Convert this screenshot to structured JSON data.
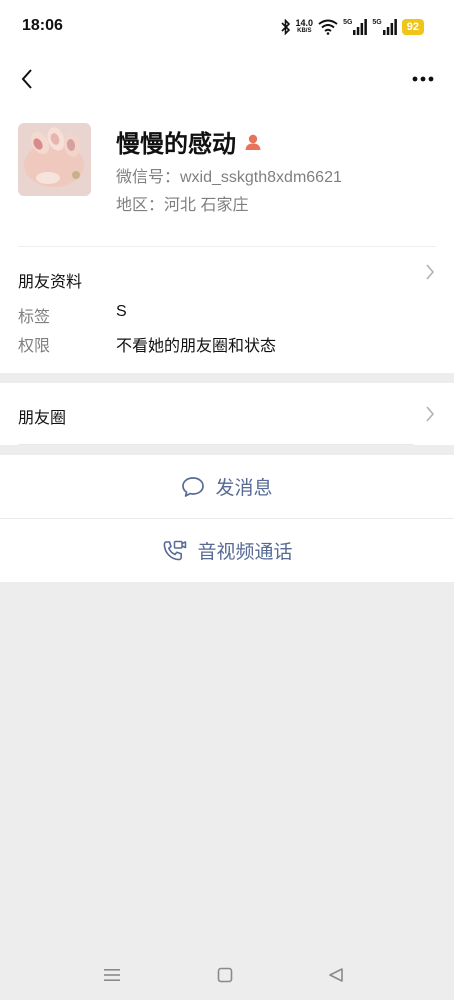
{
  "status_bar": {
    "time": "18:06",
    "net_speed_value": "14.0",
    "net_speed_unit": "KB/S",
    "signal_1_label": "5G",
    "signal_2_label": "5G",
    "battery": "92",
    "battery_color": "#f0c419"
  },
  "nav": {
    "back_icon": "chevron-left-icon",
    "more_icon": "ellipsis-icon"
  },
  "profile": {
    "nickname": "慢慢的感动",
    "gender_icon": "female-person-icon",
    "wechat_id": "微信号：wxid_sskgth8xdm6621",
    "region": "地区：河北  石家庄"
  },
  "friend_info": {
    "title": "朋友资料",
    "rows": [
      {
        "label": "标签",
        "value": "S"
      },
      {
        "label": "权限",
        "value": "不看她的朋友圈和状态"
      }
    ]
  },
  "moments": {
    "label": "朋友圈"
  },
  "actions": {
    "send_message": "发消息",
    "call": "音视频通话",
    "accent_color": "#576b95"
  },
  "system_nav": {
    "menu_icon": "menu-icon",
    "home_icon": "square-home-icon",
    "back_icon": "triangle-back-icon"
  }
}
